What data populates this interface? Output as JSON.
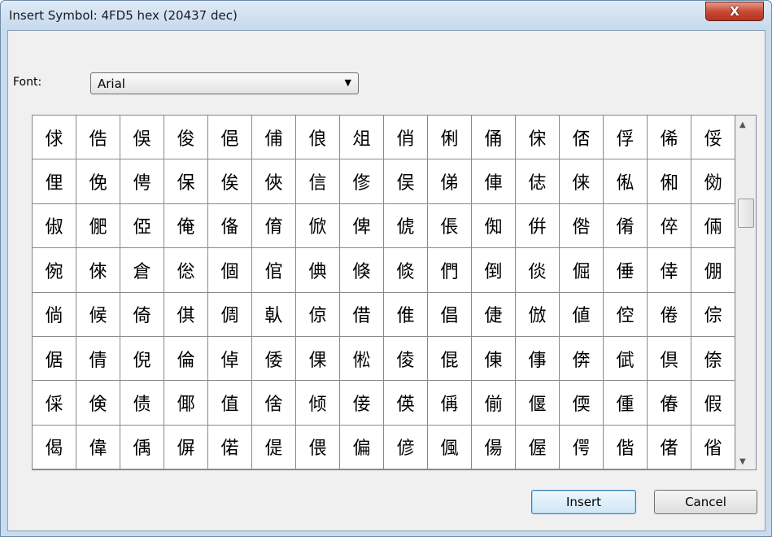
{
  "window": {
    "title": "Insert Symbol: 4FD5 hex (20437 dec)",
    "close_glyph": "X"
  },
  "font_picker": {
    "label": "Font:",
    "value": "Arial"
  },
  "symbol_grid": {
    "rows": [
      [
        "俅",
        "俈",
        "俁",
        "俊",
        "俋",
        "俌",
        "俍",
        "俎",
        "俏",
        "俐",
        "俑",
        "俕",
        "俖",
        "俘",
        "俙",
        "俀"
      ],
      [
        "俚",
        "俛",
        "俜",
        "保",
        "俟",
        "俠",
        "信",
        "俢",
        "俣",
        "俤",
        "俥",
        "俧",
        "俫",
        "俬",
        "俰",
        "俲"
      ],
      [
        "俶",
        "俷",
        "俹",
        "俺",
        "俻",
        "俼",
        "俽",
        "俾",
        "俿",
        "倀",
        "倁",
        "倂",
        "倃",
        "倄",
        "倅",
        "倆"
      ],
      [
        "倇",
        "倈",
        "倉",
        "倊",
        "個",
        "倌",
        "倎",
        "倏",
        "倐",
        "們",
        "倒",
        "倓",
        "倔",
        "倕",
        "倖",
        "倗"
      ],
      [
        "倘",
        "候",
        "倚",
        "倛",
        "倜",
        "倝",
        "倞",
        "借",
        "倠",
        "倡",
        "倢",
        "倣",
        "値",
        "倥",
        "倦",
        "倧"
      ],
      [
        "倨",
        "倩",
        "倪",
        "倫",
        "倬",
        "倭",
        "倮",
        "倯",
        "倰",
        "倱",
        "倲",
        "倳",
        "倴",
        "倵",
        "倶",
        "倷"
      ],
      [
        "倸",
        "倹",
        "债",
        "倻",
        "值",
        "倽",
        "倾",
        "倿",
        "偀",
        "偁",
        "偂",
        "偃",
        "偄",
        "偅",
        "偆",
        "假"
      ],
      [
        "偈",
        "偉",
        "偊",
        "偋",
        "偌",
        "偍",
        "偎",
        "偏",
        "偐",
        "偑",
        "偒",
        "偓",
        "偔",
        "偕",
        "偖",
        "偗"
      ]
    ]
  },
  "buttons": {
    "insert": "Insert",
    "cancel": "Cancel"
  },
  "icons": {
    "dropdown": "chevron-down-icon",
    "scroll_up": "scroll-up-arrow-icon",
    "scroll_down": "scroll-down-arrow-icon"
  }
}
